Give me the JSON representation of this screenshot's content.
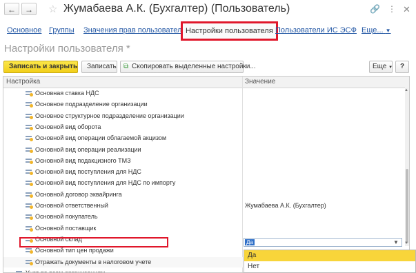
{
  "window": {
    "back_icon": "arrow-left-icon",
    "forward_icon": "arrow-right-icon",
    "title": "Жумабаева А.К. (Бухгалтер) (Пользователь)",
    "icons": [
      "link-icon",
      "more-icon",
      "close-icon"
    ]
  },
  "tabs": [
    {
      "label": "Основное"
    },
    {
      "label": "Группы"
    },
    {
      "label": "Значения прав пользователя"
    },
    {
      "label": "Настройки пользователя",
      "active": true
    },
    {
      "label": "Пользователи ИС ЭСФ"
    },
    {
      "label": "Еще..."
    }
  ],
  "form": {
    "title": "Настройки пользователя *"
  },
  "toolbar": {
    "save_close": "Записать и закрыть",
    "save": "Записать",
    "copy": "Скопировать выделенные настройки...",
    "more": "Еще",
    "help": "?"
  },
  "grid": {
    "columns": [
      "Настройка",
      "Значение"
    ],
    "rows": [
      {
        "name": "Основная ставка НДС",
        "value": ""
      },
      {
        "name": "Основное подразделение организации",
        "value": ""
      },
      {
        "name": "Основное структурное подразделение организации",
        "value": ""
      },
      {
        "name": "Основной вид оборота",
        "value": ""
      },
      {
        "name": "Основной вид операции облагаемой акцизом",
        "value": ""
      },
      {
        "name": "Основной вид операции реализации",
        "value": ""
      },
      {
        "name": "Основной вид подакцизного ТМЗ",
        "value": ""
      },
      {
        "name": "Основной вид поступления для НДС",
        "value": ""
      },
      {
        "name": "Основной вид поступления для НДС по импорту",
        "value": ""
      },
      {
        "name": "Основной договор эквайринга",
        "value": ""
      },
      {
        "name": "Основной ответственный",
        "value": "Жумабаева А.К. (Бухгалтер)"
      },
      {
        "name": "Основной покупатель",
        "value": ""
      },
      {
        "name": "Основной поставщик",
        "value": ""
      },
      {
        "name": "Основной склад",
        "value": ""
      },
      {
        "name": "Основной тип цен продажи",
        "value": ""
      },
      {
        "name": "Отражать документы в налоговом учете",
        "value": "Да"
      },
      {
        "name": "Учет по всем организациям",
        "value": ""
      }
    ]
  },
  "dropdown": {
    "options": [
      "Да",
      "Нет"
    ],
    "selected": "Да"
  },
  "colors": {
    "accent": "#f2cf19",
    "link": "#2458a5",
    "highlight": "#e0172b",
    "selection": "#3070c8"
  }
}
